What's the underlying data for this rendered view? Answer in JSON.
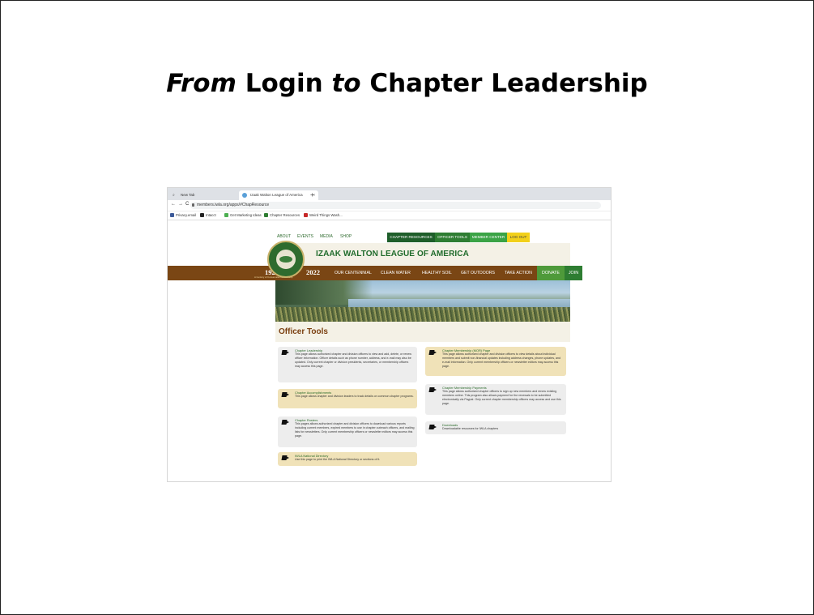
{
  "slide": {
    "title_from": "From",
    "title_login": "Login",
    "title_to": "to",
    "title_rest": "Chapter Leadership",
    "arrow": "→"
  },
  "browser": {
    "tabs": [
      {
        "label": "New Tab",
        "icon": "search-icon"
      },
      {
        "label": "Izaak Walton League of America",
        "icon": "globe-icon"
      }
    ],
    "url": "members.iwla.org/apps/#ChapResource",
    "bookmarks": [
      "Privacy.email",
      "Intacct",
      "Get Marketing Ideas",
      "Chapter Resources",
      "Weird Things Wash..."
    ]
  },
  "site": {
    "top_links": [
      "ABOUT",
      "EVENTS",
      "MEDIA",
      "SHOP"
    ],
    "top_buttons": [
      {
        "label": "CHAPTER RESOURCES",
        "color": "#1e5e2a"
      },
      {
        "label": "OFFICER TOOLS",
        "color": "#2e7d32"
      },
      {
        "label": "MEMBER CENTER",
        "color": "#3aa346"
      },
      {
        "label": "LOG OUT",
        "color": "#f2d01a"
      }
    ],
    "org_name": "IZAAK WALTON LEAGUE OF AMERICA",
    "year_start": "1922",
    "year_end": "2022",
    "tagline": "A Century of Conservation Leadership",
    "main_nav": [
      "OUR CENTENNIAL",
      "CLEAN WATER",
      "HEALTHY SOIL",
      "GET OUTDOORS",
      "TAKE ACTION"
    ],
    "donate": "DONATE",
    "join": "JOIN",
    "section_title": "Officer Tools"
  },
  "tools": [
    {
      "title": "Chapter Leadership",
      "desc": "This page allows authorized chapter and division officers to view and add, delete, or renew officer information. Officer details such as phone number, address, and e-mail may also be updated. Only current chapter or division presidents, secretaries, or membership officers may access this page.",
      "style": "grey"
    },
    {
      "title": "Chapter Membership (MOR) Page",
      "desc": "This page allows authorized chapter and division officers to view details about individual members and submit non-financial updates including address changes, phone updates, and e-mail information. Only current membership officers or newsletter editors may access this page.",
      "style": "tan"
    },
    {
      "title": "Chapter Accomplishments",
      "desc": "This page allows chapter and division leaders to track details on common chapter programs.",
      "style": "tan"
    },
    {
      "title": "Chapter Membership Payments",
      "desc": "This page allows authorized chapter officers to sign up new members and renew existing members online. This program also allows payment for the renewals to be submitted electronically via Paypal. Only current chapter membership officers may access and use this page.",
      "style": "grey"
    },
    {
      "title": "Chapter Rosters",
      "desc": "This pages allows authorized chapter and division officers to download various reports including current members, expired members to use in chapter outreach officers, and mailing lists for newsletters. Only current membership officers or newsletter editors may access this page.",
      "style": "grey"
    },
    {
      "title": "Downloads",
      "desc": "Downloadable resources for IWLA chapters",
      "style": "grey"
    },
    {
      "title": "IWLA National Directory",
      "desc": "Use this page to print the IWLA National Directory or sections of it.",
      "style": "tan"
    }
  ]
}
